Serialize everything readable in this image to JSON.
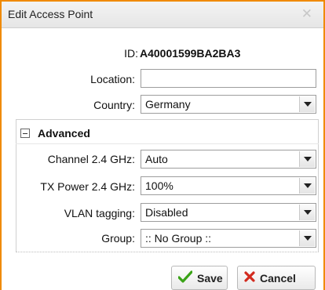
{
  "dialog": {
    "title": "Edit Access Point",
    "close_glyph": "✕"
  },
  "form": {
    "id_label": "ID:",
    "id_value": "A40001599BA2BA3",
    "location_label": "Location:",
    "location_value": "",
    "country_label": "Country:",
    "country_value": "Germany"
  },
  "advanced": {
    "legend": "Advanced",
    "channel_label": "Channel 2.4 GHz:",
    "channel_value": "Auto",
    "txpower_label": "TX Power 2.4 GHz:",
    "txpower_value": "100%",
    "vlan_label": "VLAN tagging:",
    "vlan_value": "Disabled",
    "group_label": "Group:",
    "group_value": ":: No Group ::"
  },
  "buttons": {
    "save_label": "Save",
    "save_icon": "checkmark-icon",
    "cancel_label": "Cancel",
    "cancel_icon": "x-icon"
  },
  "colors": {
    "border_accent": "#f08a00",
    "save_icon": "#3aa317",
    "cancel_icon": "#d22a1e"
  }
}
